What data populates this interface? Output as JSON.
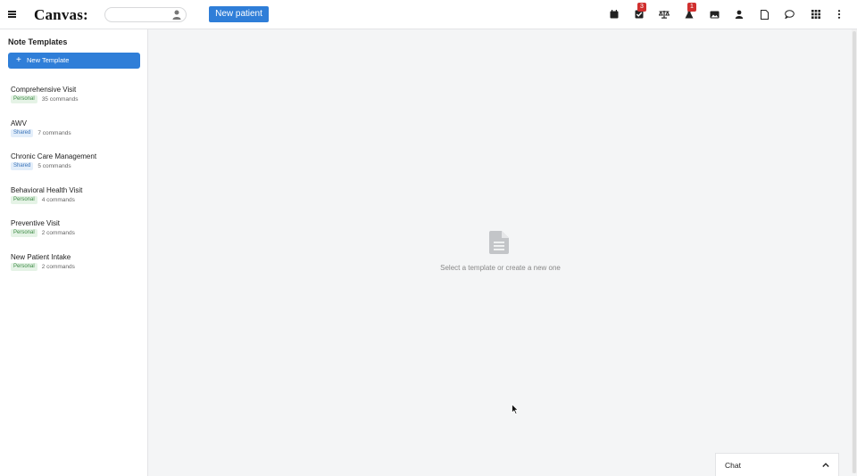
{
  "header": {
    "logo": "Canvas:",
    "search_placeholder": "",
    "new_patient_label": "New patient",
    "badges": {
      "tasks": "3",
      "labs": "1"
    }
  },
  "sidebar": {
    "title": "Note Templates",
    "new_template_label": "New Template",
    "templates": [
      {
        "name": "Comprehensive Visit",
        "tag": "Personal",
        "commands": "35 commands"
      },
      {
        "name": "AWV",
        "tag": "Shared",
        "commands": "7 commands"
      },
      {
        "name": "Chronic Care Management",
        "tag": "Shared",
        "commands": "5 commands"
      },
      {
        "name": "Behavioral Health Visit",
        "tag": "Personal",
        "commands": "4 commands"
      },
      {
        "name": "Preventive Visit",
        "tag": "Personal",
        "commands": "2 commands"
      },
      {
        "name": "New Patient Intake",
        "tag": "Personal",
        "commands": "2 commands"
      }
    ]
  },
  "main": {
    "empty_message": "Select a template or create a new one"
  },
  "chat": {
    "label": "Chat"
  },
  "colors": {
    "primary": "#2f7ed8",
    "badge": "#d0302f",
    "personal": "#3c8a44",
    "shared": "#3a73b8"
  }
}
